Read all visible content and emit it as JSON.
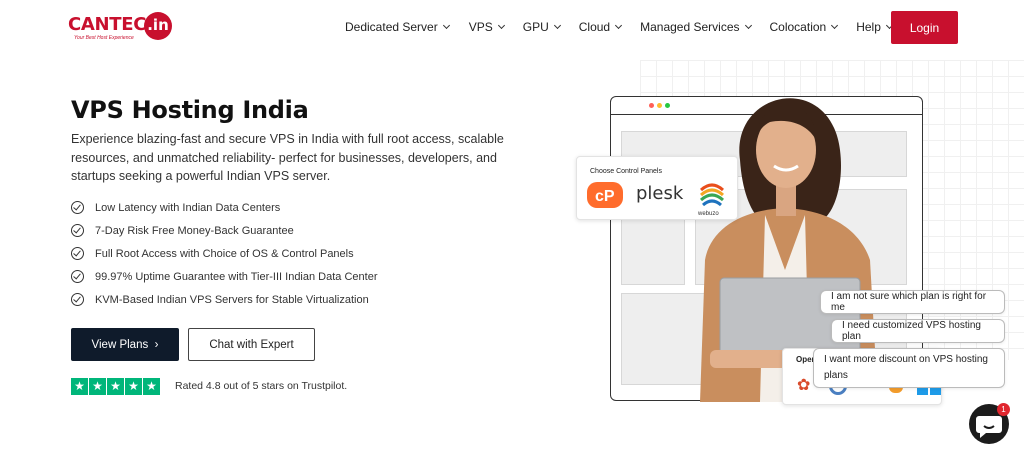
{
  "brand": {
    "name": "CANTECH",
    "suffix": ".in",
    "tagline": "Your Best Host Experience"
  },
  "nav": {
    "items": [
      {
        "label": "Dedicated Server"
      },
      {
        "label": "VPS"
      },
      {
        "label": "GPU"
      },
      {
        "label": "Cloud"
      },
      {
        "label": "Managed Services"
      },
      {
        "label": "Colocation"
      },
      {
        "label": "Help"
      }
    ],
    "login_label": "Login"
  },
  "hero": {
    "title": "VPS Hosting India",
    "description": "Experience blazing-fast and secure VPS in India with full root access, scalable resources, and unmatched reliability- perfect for businesses, developers, and startups seeking a powerful Indian VPS server.",
    "features": [
      "Low Latency with Indian Data Centers",
      "7-Day Risk Free Money-Back Guarantee",
      "Full Root Access with Choice of OS & Control Panels",
      "99.97% Uptime Guarantee with Tier-III Indian Data Center",
      "KVM-Based Indian VPS Servers for Stable Virtualization"
    ],
    "view_plans_label": "View Plans",
    "chat_label": "Chat with Expert",
    "rating_text": "Rated 4.8 out of 5 stars on Trustpilot.",
    "rating_stars": 5
  },
  "control_panels": {
    "title": "Choose Control Panels",
    "plesk": "plesk",
    "webuzo": "webuzo"
  },
  "os_card": {
    "title": "Oper"
  },
  "chat": {
    "suggestions": [
      "I am not sure which plan is right for me",
      "I need customized VPS hosting plan",
      "I want more discount on VPS hosting plans"
    ],
    "unread_count": "1"
  },
  "colors": {
    "brand_red": "#c8102e",
    "dark_navy": "#0f1b2b",
    "trustpilot_green": "#00b67a"
  }
}
